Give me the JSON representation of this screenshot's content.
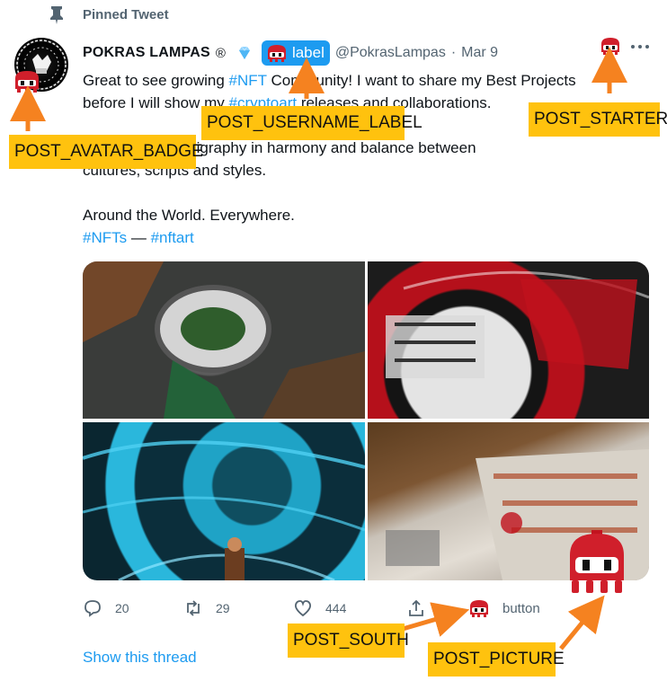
{
  "pinned": {
    "label": "Pinned Tweet"
  },
  "author": {
    "name": "POKRAS LAMPAS",
    "registered_mark": "®",
    "handle": "@PokrasLampas",
    "separator": "·",
    "date": "Mar 9"
  },
  "username_label": {
    "text": "label"
  },
  "tweet": {
    "line1_a": "Great to see growing ",
    "line1_link": "#NFT",
    "line1_b": " Community! I want to share my Best Projects",
    "line2_a": "before I will show my ",
    "line2_link": "#cryptoart",
    "line2_b": " releases and collaborations.",
    "line3": "The future of calligraphy in harmony and balance between",
    "line4": "cultures, scripts and styles.",
    "line5": "Around the World. Everywhere.",
    "line6_link1": "#NFTs",
    "line6_sep": " — ",
    "line6_link2": "#nftart"
  },
  "actions": {
    "replies": "20",
    "retweets": "29",
    "likes": "444",
    "button_label": "button"
  },
  "show_thread": "Show this thread",
  "annotations": {
    "avatar_badge": "POST_AVATAR_BADGE",
    "username_label": "POST_USERNAME_LABEL",
    "starter": "POST_STARTER",
    "south": "POST_SOUTH",
    "picture": "POST_PICTURE"
  },
  "colors": {
    "link": "#1d9bf0",
    "annotation": "#ffc20e",
    "arrow": "#f58220",
    "bot_red": "#d01f2b"
  },
  "icons": [
    "pin-icon",
    "diamond-icon",
    "more-icon",
    "reply-icon",
    "retweet-icon",
    "like-icon",
    "share-icon",
    "bot-icon"
  ]
}
